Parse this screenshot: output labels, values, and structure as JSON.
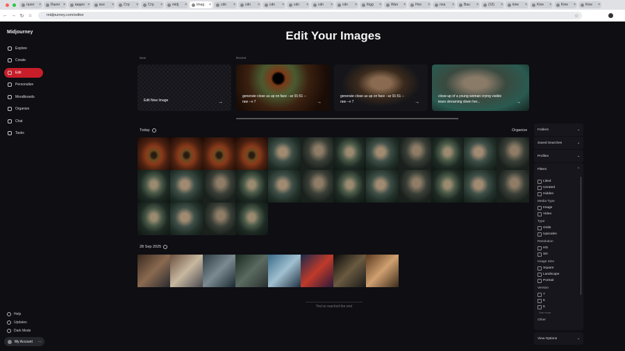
{
  "browser": {
    "tabs": [
      "razer",
      "Razer",
      "видео",
      "все",
      "Стр",
      "Стр",
      "midj",
      "Imag",
      "cdn",
      "cdn",
      "cdn",
      "cdn",
      "cdn",
      "cdn",
      "frigg",
      "Wan",
      "Hos",
      "nna",
      "Bau",
      "(10)",
      "kine",
      "Kine",
      "Kine",
      "Kine"
    ],
    "active_tab": 7,
    "url": "midjourney.com/editor"
  },
  "sidebar": {
    "brand": "Midjourney",
    "items": [
      {
        "label": "Explore"
      },
      {
        "label": "Create"
      },
      {
        "label": "Edit"
      },
      {
        "label": "Personalize"
      },
      {
        "label": "Moodboards"
      },
      {
        "label": "Organize"
      },
      {
        "label": "Chat"
      },
      {
        "label": "Tasks"
      }
    ],
    "active": "Edit",
    "bottom": [
      "Help",
      "Updates",
      "Dark Mode"
    ],
    "account": "My Account"
  },
  "main": {
    "title": "Edit Your Images",
    "new_label": "New",
    "recent_label": "Recent",
    "new_card": "Edit New Image",
    "recent": [
      "generate close us up on face --ar 91:51 --raw --v 7",
      "generate close us up on face --ar 91:51 --raw --v 7",
      "close-up of a young woman crying visible tears streaming down her..."
    ],
    "organize": "Organize",
    "sections": [
      {
        "label": "Today",
        "count": 28
      },
      {
        "label": "28 Sep 2025",
        "count": 8
      }
    ],
    "end_text": "You've reached the end"
  },
  "panel": {
    "folders": "Folders",
    "saved": "Saved Searches",
    "profiles": "Profiles",
    "filters": "Filters",
    "view_options": "View Options",
    "groups": [
      {
        "title": "",
        "items": [
          "Liked",
          "Unrated",
          "Hidden"
        ]
      },
      {
        "title": "Media Type",
        "items": [
          "Image",
          "Video"
        ]
      },
      {
        "title": "Type",
        "items": [
          "Grids",
          "Upscales"
        ]
      },
      {
        "title": "Resolution",
        "items": [
          "HD",
          "SD"
        ]
      },
      {
        "title": "Image Size",
        "items": [
          "Square",
          "Landscape",
          "Portrait"
        ]
      },
      {
        "title": "Version",
        "items": [
          "7",
          "6",
          "5"
        ]
      }
    ],
    "see_more": "See more",
    "other": "Other"
  }
}
